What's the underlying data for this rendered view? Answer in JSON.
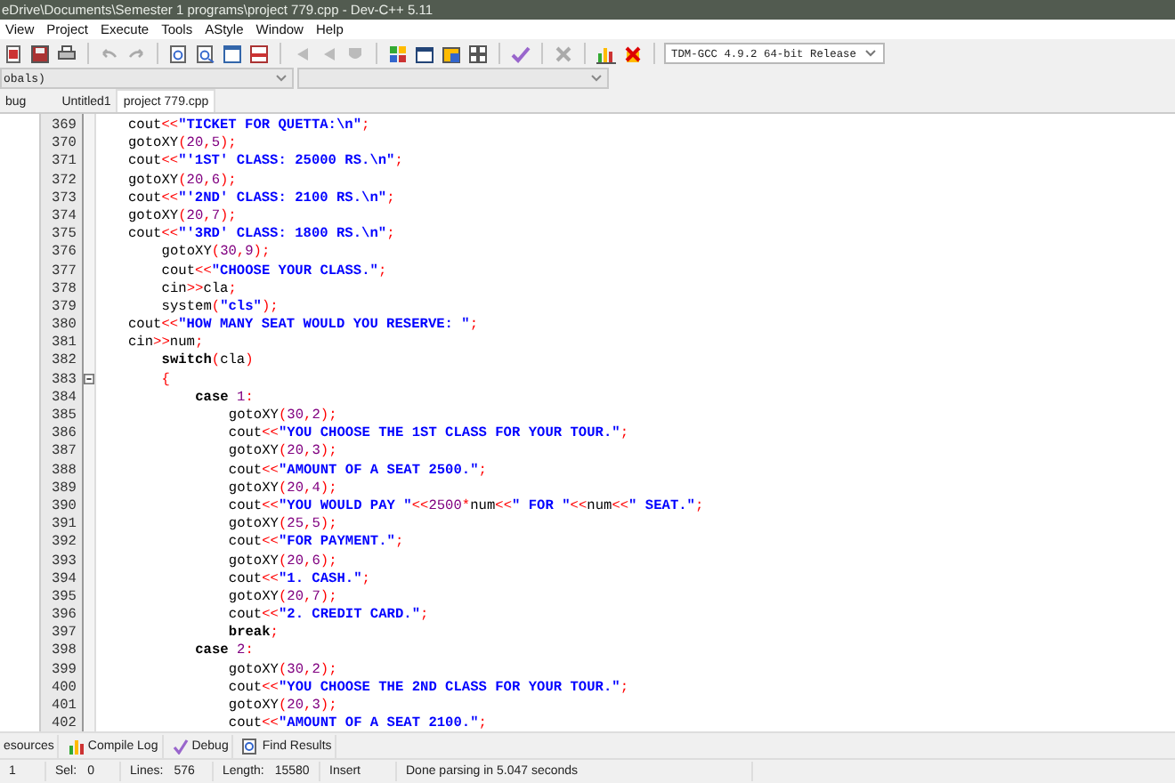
{
  "window": {
    "title": "eDrive\\Documents\\Semester 1 programs\\project 779.cpp - Dev-C++ 5.11"
  },
  "menu": [
    "View",
    "Project",
    "Execute",
    "Tools",
    "AStyle",
    "Window",
    "Help"
  ],
  "toolbar": {
    "compiler_select": "TDM-GCC 4.9.2 64-bit Release"
  },
  "class_select": "obals)",
  "left_tabs": [
    {
      "label": "bug",
      "selected": false
    }
  ],
  "editor_tabs": [
    {
      "label": "Untitled1",
      "selected": false
    },
    {
      "label": "project 779.cpp",
      "selected": true
    }
  ],
  "editor": {
    "lines": [
      {
        "num": "369",
        "tokens": [
          {
            "kind": "id",
            "text": "cout"
          },
          {
            "kind": "op",
            "text": "<<"
          },
          {
            "kind": "str",
            "text": "\"TICKET FOR QUETTA:\\n\""
          },
          {
            "kind": "op",
            "text": ";"
          }
        ]
      },
      {
        "num": "370",
        "tokens": [
          {
            "kind": "id",
            "text": "gotoXY"
          },
          {
            "kind": "op",
            "text": "("
          },
          {
            "kind": "num",
            "text": "20"
          },
          {
            "kind": "op",
            "text": ","
          },
          {
            "kind": "num",
            "text": "5"
          },
          {
            "kind": "op",
            "text": ");"
          }
        ]
      },
      {
        "num": "371",
        "tokens": [
          {
            "kind": "id",
            "text": "cout"
          },
          {
            "kind": "op",
            "text": "<<"
          },
          {
            "kind": "str",
            "text": "\"'1ST' CLASS: 25000 RS.\\n\""
          },
          {
            "kind": "op",
            "text": ";"
          }
        ]
      },
      {
        "num": "372",
        "tokens": [
          {
            "kind": "id",
            "text": "gotoXY"
          },
          {
            "kind": "op",
            "text": "("
          },
          {
            "kind": "num",
            "text": "20"
          },
          {
            "kind": "op",
            "text": ","
          },
          {
            "kind": "num",
            "text": "6"
          },
          {
            "kind": "op",
            "text": ");"
          }
        ]
      },
      {
        "num": "373",
        "tokens": [
          {
            "kind": "id",
            "text": "cout"
          },
          {
            "kind": "op",
            "text": "<<"
          },
          {
            "kind": "str",
            "text": "\"'2ND' CLASS: 2100 RS.\\n\""
          },
          {
            "kind": "op",
            "text": ";"
          }
        ]
      },
      {
        "num": "374",
        "tokens": [
          {
            "kind": "id",
            "text": "gotoXY"
          },
          {
            "kind": "op",
            "text": "("
          },
          {
            "kind": "num",
            "text": "20"
          },
          {
            "kind": "op",
            "text": ","
          },
          {
            "kind": "num",
            "text": "7"
          },
          {
            "kind": "op",
            "text": ");"
          }
        ]
      },
      {
        "num": "375",
        "tokens": [
          {
            "kind": "id",
            "text": "cout"
          },
          {
            "kind": "op",
            "text": "<<"
          },
          {
            "kind": "str",
            "text": "\"'3RD' CLASS: 1800 RS.\\n\""
          },
          {
            "kind": "op",
            "text": ";"
          }
        ],
        "children": [
          {
            "num": "376",
            "tokens": [
              {
                "kind": "id",
                "text": "gotoXY"
              },
              {
                "kind": "op",
                "text": "("
              },
              {
                "kind": "num",
                "text": "30"
              },
              {
                "kind": "op",
                "text": ","
              },
              {
                "kind": "num",
                "text": "9"
              },
              {
                "kind": "op",
                "text": ");"
              }
            ]
          },
          {
            "num": "377",
            "tokens": [
              {
                "kind": "id",
                "text": "cout"
              },
              {
                "kind": "op",
                "text": "<<"
              },
              {
                "kind": "str",
                "text": "\"CHOOSE YOUR CLASS.\""
              },
              {
                "kind": "op",
                "text": ";"
              }
            ]
          },
          {
            "num": "378",
            "tokens": [
              {
                "kind": "id",
                "text": "cin"
              },
              {
                "kind": "op",
                "text": ">>"
              },
              {
                "kind": "id",
                "text": "cla"
              },
              {
                "kind": "op",
                "text": ";"
              }
            ]
          },
          {
            "num": "379",
            "tokens": [
              {
                "kind": "id",
                "text": "system"
              },
              {
                "kind": "op",
                "text": "("
              },
              {
                "kind": "str",
                "text": "\"cls\""
              },
              {
                "kind": "op",
                "text": ");"
              }
            ]
          }
        ]
      },
      {
        "num": "380",
        "tokens": [
          {
            "kind": "id",
            "text": "cout"
          },
          {
            "kind": "op",
            "text": "<<"
          },
          {
            "kind": "str",
            "text": "\"HOW MANY SEAT WOULD YOU RESERVE: \""
          },
          {
            "kind": "op",
            "text": ";"
          }
        ]
      },
      {
        "num": "381",
        "tokens": [
          {
            "kind": "id",
            "text": "cin"
          },
          {
            "kind": "op",
            "text": ">>"
          },
          {
            "kind": "id",
            "text": "num"
          },
          {
            "kind": "op",
            "text": ";"
          }
        ],
        "children": [
          {
            "num": "382",
            "tokens": [
              {
                "kind": "kw",
                "text": "switch"
              },
              {
                "kind": "op",
                "text": "("
              },
              {
                "kind": "id",
                "text": "cla"
              },
              {
                "kind": "op",
                "text": ")"
              }
            ]
          },
          {
            "num": "383",
            "expanded": true,
            "tokens": [
              {
                "kind": "op",
                "text": "{"
              }
            ],
            "children": [
              {
                "num": "384",
                "tokens": [
                  {
                    "kind": "kw",
                    "text": "case "
                  },
                  {
                    "kind": "num",
                    "text": "1"
                  },
                  {
                    "kind": "op",
                    "text": ":"
                  }
                ],
                "children": [
                  {
                    "num": "385",
                    "tokens": [
                      {
                        "kind": "id",
                        "text": "gotoXY"
                      },
                      {
                        "kind": "op",
                        "text": "("
                      },
                      {
                        "kind": "num",
                        "text": "30"
                      },
                      {
                        "kind": "op",
                        "text": ","
                      },
                      {
                        "kind": "num",
                        "text": "2"
                      },
                      {
                        "kind": "op",
                        "text": ");"
                      }
                    ]
                  },
                  {
                    "num": "386",
                    "tokens": [
                      {
                        "kind": "id",
                        "text": "cout"
                      },
                      {
                        "kind": "op",
                        "text": "<<"
                      },
                      {
                        "kind": "str",
                        "text": "\"YOU CHOOSE THE 1ST CLASS FOR YOUR TOUR.\""
                      },
                      {
                        "kind": "op",
                        "text": ";"
                      }
                    ]
                  },
                  {
                    "num": "387",
                    "tokens": [
                      {
                        "kind": "id",
                        "text": "gotoXY"
                      },
                      {
                        "kind": "op",
                        "text": "("
                      },
                      {
                        "kind": "num",
                        "text": "20"
                      },
                      {
                        "kind": "op",
                        "text": ","
                      },
                      {
                        "kind": "num",
                        "text": "3"
                      },
                      {
                        "kind": "op",
                        "text": ");"
                      }
                    ]
                  },
                  {
                    "num": "388",
                    "tokens": [
                      {
                        "kind": "id",
                        "text": "cout"
                      },
                      {
                        "kind": "op",
                        "text": "<<"
                      },
                      {
                        "kind": "str",
                        "text": "\"AMOUNT OF A SEAT 2500.\""
                      },
                      {
                        "kind": "op",
                        "text": ";"
                      }
                    ]
                  },
                  {
                    "num": "389",
                    "tokens": [
                      {
                        "kind": "id",
                        "text": "gotoXY"
                      },
                      {
                        "kind": "op",
                        "text": "("
                      },
                      {
                        "kind": "num",
                        "text": "20"
                      },
                      {
                        "kind": "op",
                        "text": ","
                      },
                      {
                        "kind": "num",
                        "text": "4"
                      },
                      {
                        "kind": "op",
                        "text": ");"
                      }
                    ]
                  },
                  {
                    "num": "390",
                    "tokens": [
                      {
                        "kind": "id",
                        "text": "cout"
                      },
                      {
                        "kind": "op",
                        "text": "<<"
                      },
                      {
                        "kind": "str",
                        "text": "\"YOU WOULD PAY \""
                      },
                      {
                        "kind": "op",
                        "text": "<<"
                      },
                      {
                        "kind": "num",
                        "text": "2500"
                      },
                      {
                        "kind": "op",
                        "text": "*"
                      },
                      {
                        "kind": "id",
                        "text": "num"
                      },
                      {
                        "kind": "op",
                        "text": "<<"
                      },
                      {
                        "kind": "str",
                        "text": "\" FOR \""
                      },
                      {
                        "kind": "op",
                        "text": "<<"
                      },
                      {
                        "kind": "id",
                        "text": "num"
                      },
                      {
                        "kind": "op",
                        "text": "<<"
                      },
                      {
                        "kind": "str",
                        "text": "\" SEAT.\""
                      },
                      {
                        "kind": "op",
                        "text": ";"
                      }
                    ]
                  },
                  {
                    "num": "391",
                    "tokens": [
                      {
                        "kind": "id",
                        "text": "gotoXY"
                      },
                      {
                        "kind": "op",
                        "text": "("
                      },
                      {
                        "kind": "num",
                        "text": "25"
                      },
                      {
                        "kind": "op",
                        "text": ","
                      },
                      {
                        "kind": "num",
                        "text": "5"
                      },
                      {
                        "kind": "op",
                        "text": ");"
                      }
                    ]
                  },
                  {
                    "num": "392",
                    "tokens": [
                      {
                        "kind": "id",
                        "text": "cout"
                      },
                      {
                        "kind": "op",
                        "text": "<<"
                      },
                      {
                        "kind": "str",
                        "text": "\"FOR PAYMENT.\""
                      },
                      {
                        "kind": "op",
                        "text": ";"
                      }
                    ]
                  },
                  {
                    "num": "393",
                    "tokens": [
                      {
                        "kind": "id",
                        "text": "gotoXY"
                      },
                      {
                        "kind": "op",
                        "text": "("
                      },
                      {
                        "kind": "num",
                        "text": "20"
                      },
                      {
                        "kind": "op",
                        "text": ","
                      },
                      {
                        "kind": "num",
                        "text": "6"
                      },
                      {
                        "kind": "op",
                        "text": ");"
                      }
                    ]
                  },
                  {
                    "num": "394",
                    "tokens": [
                      {
                        "kind": "id",
                        "text": "cout"
                      },
                      {
                        "kind": "op",
                        "text": "<<"
                      },
                      {
                        "kind": "str",
                        "text": "\"1. CASH.\""
                      },
                      {
                        "kind": "op",
                        "text": ";"
                      }
                    ]
                  },
                  {
                    "num": "395",
                    "tokens": [
                      {
                        "kind": "id",
                        "text": "gotoXY"
                      },
                      {
                        "kind": "op",
                        "text": "("
                      },
                      {
                        "kind": "num",
                        "text": "20"
                      },
                      {
                        "kind": "op",
                        "text": ","
                      },
                      {
                        "kind": "num",
                        "text": "7"
                      },
                      {
                        "kind": "op",
                        "text": ");"
                      }
                    ]
                  },
                  {
                    "num": "396",
                    "tokens": [
                      {
                        "kind": "id",
                        "text": "cout"
                      },
                      {
                        "kind": "op",
                        "text": "<<"
                      },
                      {
                        "kind": "str",
                        "text": "\"2. CREDIT CARD.\""
                      },
                      {
                        "kind": "op",
                        "text": ";"
                      }
                    ]
                  },
                  {
                    "num": "397",
                    "tokens": [
                      {
                        "kind": "kw",
                        "text": "break"
                      },
                      {
                        "kind": "op",
                        "text": ";"
                      }
                    ]
                  }
                ]
              },
              {
                "num": "398",
                "tokens": [
                  {
                    "kind": "kw",
                    "text": "case "
                  },
                  {
                    "kind": "num",
                    "text": "2"
                  },
                  {
                    "kind": "op",
                    "text": ":"
                  }
                ],
                "children": [
                  {
                    "num": "399",
                    "tokens": [
                      {
                        "kind": "id",
                        "text": "gotoXY"
                      },
                      {
                        "kind": "op",
                        "text": "("
                      },
                      {
                        "kind": "num",
                        "text": "30"
                      },
                      {
                        "kind": "op",
                        "text": ","
                      },
                      {
                        "kind": "num",
                        "text": "2"
                      },
                      {
                        "kind": "op",
                        "text": ");"
                      }
                    ]
                  },
                  {
                    "num": "400",
                    "tokens": [
                      {
                        "kind": "id",
                        "text": "cout"
                      },
                      {
                        "kind": "op",
                        "text": "<<"
                      },
                      {
                        "kind": "str",
                        "text": "\"YOU CHOOSE THE 2ND CLASS FOR YOUR TOUR.\""
                      },
                      {
                        "kind": "op",
                        "text": ";"
                      }
                    ]
                  },
                  {
                    "num": "401",
                    "tokens": [
                      {
                        "kind": "id",
                        "text": "gotoXY"
                      },
                      {
                        "kind": "op",
                        "text": "("
                      },
                      {
                        "kind": "num",
                        "text": "20"
                      },
                      {
                        "kind": "op",
                        "text": ","
                      },
                      {
                        "kind": "num",
                        "text": "3"
                      },
                      {
                        "kind": "op",
                        "text": ");"
                      }
                    ]
                  },
                  {
                    "num": "402",
                    "tokens": [
                      {
                        "kind": "id",
                        "text": "cout"
                      },
                      {
                        "kind": "op",
                        "text": "<<"
                      },
                      {
                        "kind": "str",
                        "text": "\"AMOUNT OF A SEAT 2100.\""
                      },
                      {
                        "kind": "op",
                        "text": ";"
                      }
                    ]
                  }
                ]
              }
            ]
          }
        ]
      }
    ]
  },
  "bottom_tabs": [
    {
      "label": "esources"
    },
    {
      "label": "Compile Log"
    },
    {
      "label": "Debug"
    },
    {
      "label": "Find Results"
    }
  ],
  "status_bar": [
    {
      "value": "1"
    },
    {
      "label": "Sel:",
      "value": "0"
    },
    {
      "label": "Lines:",
      "value": "576"
    },
    {
      "label": "Length:",
      "value": "15580"
    },
    {
      "value": "Insert"
    },
    {
      "value": "Done parsing in 5.047 seconds"
    }
  ]
}
